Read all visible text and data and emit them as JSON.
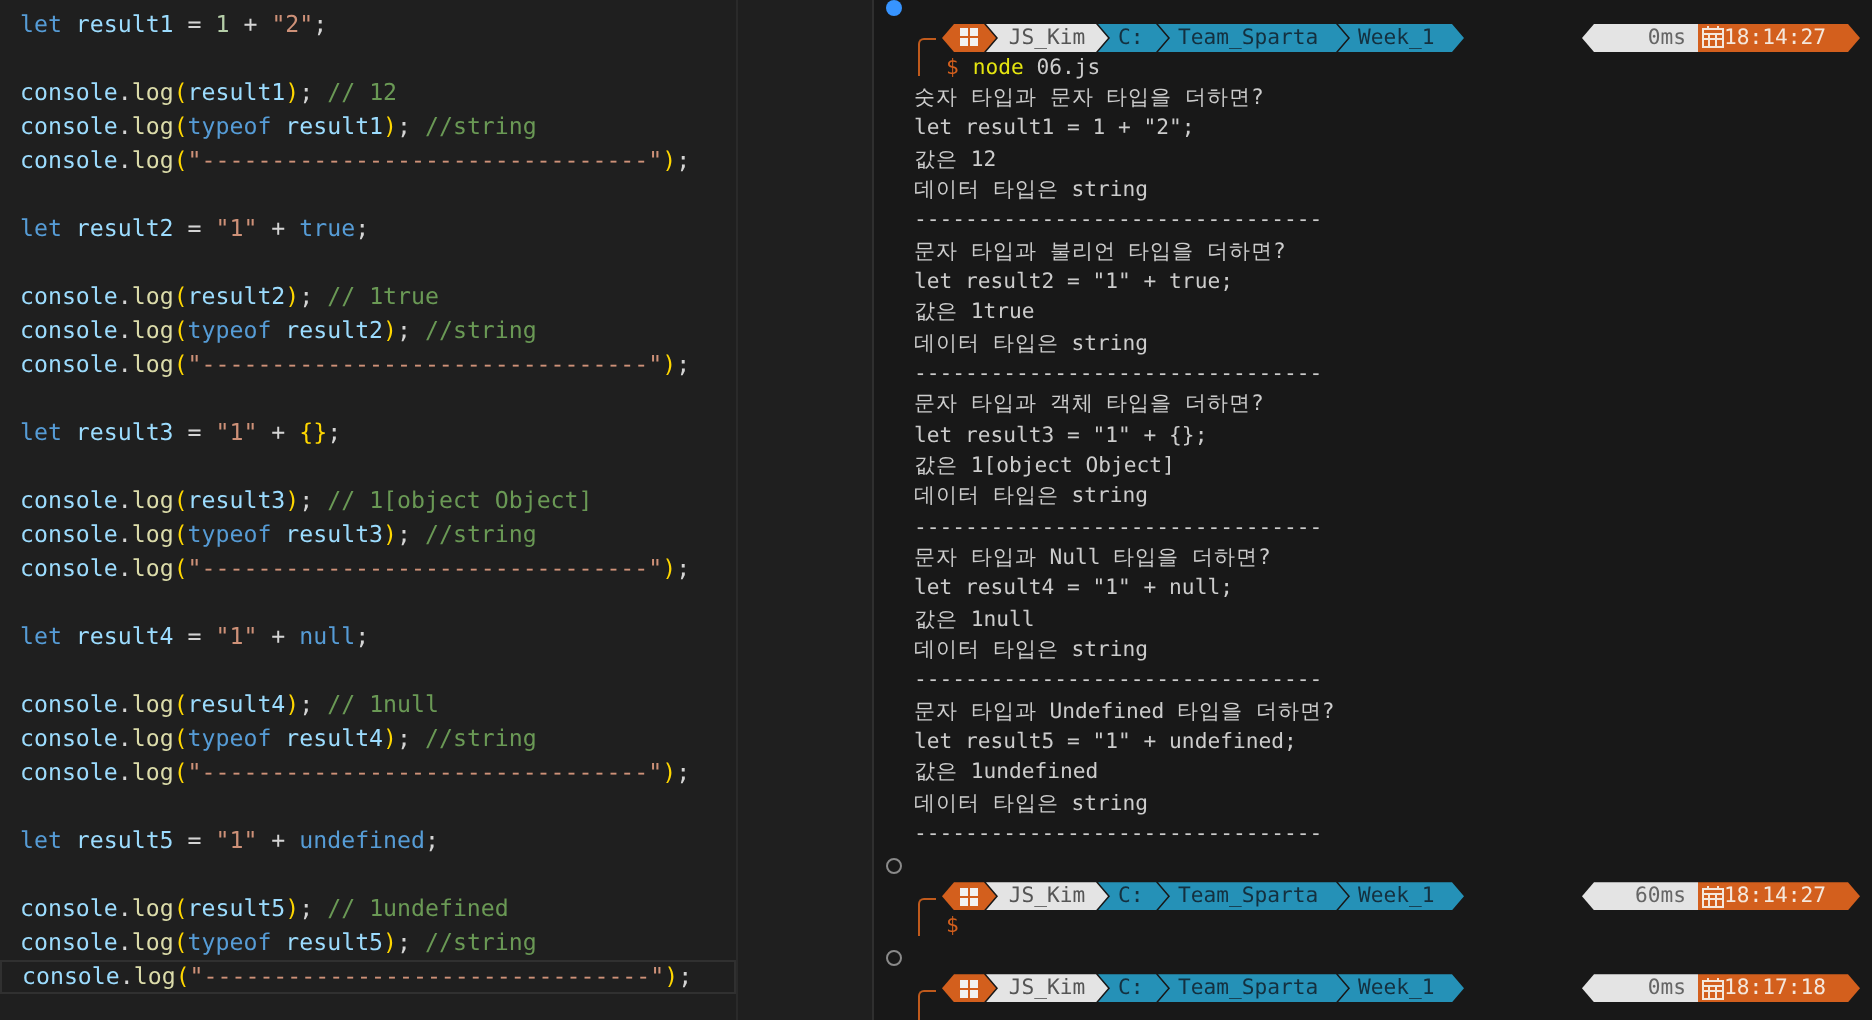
{
  "editor": {
    "lines": [
      {
        "current": false,
        "tokens": [
          {
            "kind": "kw",
            "text": "let "
          },
          {
            "kind": "var",
            "text": "result1"
          },
          {
            "kind": "op",
            "text": " = "
          },
          {
            "kind": "num",
            "text": "1"
          },
          {
            "kind": "op",
            "text": " + "
          },
          {
            "kind": "str",
            "text": "\"2\""
          },
          {
            "kind": "op",
            "text": ";"
          }
        ]
      },
      {
        "current": false
      },
      {
        "current": false,
        "tokens": [
          {
            "kind": "var",
            "text": "console"
          },
          {
            "kind": "op",
            "text": "."
          },
          {
            "kind": "fn",
            "text": "log"
          },
          {
            "kind": "paren",
            "text": "("
          },
          {
            "kind": "var",
            "text": "result1"
          },
          {
            "kind": "paren",
            "text": ")"
          },
          {
            "kind": "op",
            "text": "; "
          },
          {
            "kind": "comment",
            "text": "// 12"
          }
        ]
      },
      {
        "current": false,
        "tokens": [
          {
            "kind": "var",
            "text": "console"
          },
          {
            "kind": "op",
            "text": "."
          },
          {
            "kind": "fn",
            "text": "log"
          },
          {
            "kind": "paren",
            "text": "("
          },
          {
            "kind": "kw",
            "text": "typeof "
          },
          {
            "kind": "var",
            "text": "result1"
          },
          {
            "kind": "paren",
            "text": ")"
          },
          {
            "kind": "op",
            "text": "; "
          },
          {
            "kind": "comment",
            "text": "//string"
          }
        ]
      },
      {
        "current": false,
        "tokens": [
          {
            "kind": "var",
            "text": "console"
          },
          {
            "kind": "op",
            "text": "."
          },
          {
            "kind": "fn",
            "text": "log"
          },
          {
            "kind": "paren",
            "text": "("
          },
          {
            "kind": "str",
            "text": "\"--------------------------------\""
          },
          {
            "kind": "paren",
            "text": ")"
          },
          {
            "kind": "op",
            "text": ";"
          }
        ]
      },
      {
        "current": false
      },
      {
        "current": false,
        "tokens": [
          {
            "kind": "kw",
            "text": "let "
          },
          {
            "kind": "var",
            "text": "result2"
          },
          {
            "kind": "op",
            "text": " = "
          },
          {
            "kind": "str",
            "text": "\"1\""
          },
          {
            "kind": "op",
            "text": " + "
          },
          {
            "kind": "kw",
            "text": "true"
          },
          {
            "kind": "op",
            "text": ";"
          }
        ]
      },
      {
        "current": false
      },
      {
        "current": false,
        "tokens": [
          {
            "kind": "var",
            "text": "console"
          },
          {
            "kind": "op",
            "text": "."
          },
          {
            "kind": "fn",
            "text": "log"
          },
          {
            "kind": "paren",
            "text": "("
          },
          {
            "kind": "var",
            "text": "result2"
          },
          {
            "kind": "paren",
            "text": ")"
          },
          {
            "kind": "op",
            "text": "; "
          },
          {
            "kind": "comment",
            "text": "// 1true"
          }
        ]
      },
      {
        "current": false,
        "tokens": [
          {
            "kind": "var",
            "text": "console"
          },
          {
            "kind": "op",
            "text": "."
          },
          {
            "kind": "fn",
            "text": "log"
          },
          {
            "kind": "paren",
            "text": "("
          },
          {
            "kind": "kw",
            "text": "typeof "
          },
          {
            "kind": "var",
            "text": "result2"
          },
          {
            "kind": "paren",
            "text": ")"
          },
          {
            "kind": "op",
            "text": "; "
          },
          {
            "kind": "comment",
            "text": "//string"
          }
        ]
      },
      {
        "current": false,
        "tokens": [
          {
            "kind": "var",
            "text": "console"
          },
          {
            "kind": "op",
            "text": "."
          },
          {
            "kind": "fn",
            "text": "log"
          },
          {
            "kind": "paren",
            "text": "("
          },
          {
            "kind": "str",
            "text": "\"--------------------------------\""
          },
          {
            "kind": "paren",
            "text": ")"
          },
          {
            "kind": "op",
            "text": ";"
          }
        ]
      },
      {
        "current": false
      },
      {
        "current": false,
        "tokens": [
          {
            "kind": "kw",
            "text": "let "
          },
          {
            "kind": "var",
            "text": "result3"
          },
          {
            "kind": "op",
            "text": " = "
          },
          {
            "kind": "str",
            "text": "\"1\""
          },
          {
            "kind": "op",
            "text": " + "
          },
          {
            "kind": "paren",
            "text": "{}"
          },
          {
            "kind": "op",
            "text": ";"
          }
        ]
      },
      {
        "current": false
      },
      {
        "current": false,
        "tokens": [
          {
            "kind": "var",
            "text": "console"
          },
          {
            "kind": "op",
            "text": "."
          },
          {
            "kind": "fn",
            "text": "log"
          },
          {
            "kind": "paren",
            "text": "("
          },
          {
            "kind": "var",
            "text": "result3"
          },
          {
            "kind": "paren",
            "text": ")"
          },
          {
            "kind": "op",
            "text": "; "
          },
          {
            "kind": "comment",
            "text": "// 1[object Object]"
          }
        ]
      },
      {
        "current": false,
        "tokens": [
          {
            "kind": "var",
            "text": "console"
          },
          {
            "kind": "op",
            "text": "."
          },
          {
            "kind": "fn",
            "text": "log"
          },
          {
            "kind": "paren",
            "text": "("
          },
          {
            "kind": "kw",
            "text": "typeof "
          },
          {
            "kind": "var",
            "text": "result3"
          },
          {
            "kind": "paren",
            "text": ")"
          },
          {
            "kind": "op",
            "text": "; "
          },
          {
            "kind": "comment",
            "text": "//string"
          }
        ]
      },
      {
        "current": false,
        "tokens": [
          {
            "kind": "var",
            "text": "console"
          },
          {
            "kind": "op",
            "text": "."
          },
          {
            "kind": "fn",
            "text": "log"
          },
          {
            "kind": "paren",
            "text": "("
          },
          {
            "kind": "str",
            "text": "\"--------------------------------\""
          },
          {
            "kind": "paren",
            "text": ")"
          },
          {
            "kind": "op",
            "text": ";"
          }
        ]
      },
      {
        "current": false
      },
      {
        "current": false,
        "tokens": [
          {
            "kind": "kw",
            "text": "let "
          },
          {
            "kind": "var",
            "text": "result4"
          },
          {
            "kind": "op",
            "text": " = "
          },
          {
            "kind": "str",
            "text": "\"1\""
          },
          {
            "kind": "op",
            "text": " + "
          },
          {
            "kind": "kw",
            "text": "null"
          },
          {
            "kind": "op",
            "text": ";"
          }
        ]
      },
      {
        "current": false
      },
      {
        "current": false,
        "tokens": [
          {
            "kind": "var",
            "text": "console"
          },
          {
            "kind": "op",
            "text": "."
          },
          {
            "kind": "fn",
            "text": "log"
          },
          {
            "kind": "paren",
            "text": "("
          },
          {
            "kind": "var",
            "text": "result4"
          },
          {
            "kind": "paren",
            "text": ")"
          },
          {
            "kind": "op",
            "text": "; "
          },
          {
            "kind": "comment",
            "text": "// 1null"
          }
        ]
      },
      {
        "current": false,
        "tokens": [
          {
            "kind": "var",
            "text": "console"
          },
          {
            "kind": "op",
            "text": "."
          },
          {
            "kind": "fn",
            "text": "log"
          },
          {
            "kind": "paren",
            "text": "("
          },
          {
            "kind": "kw",
            "text": "typeof "
          },
          {
            "kind": "var",
            "text": "result4"
          },
          {
            "kind": "paren",
            "text": ")"
          },
          {
            "kind": "op",
            "text": "; "
          },
          {
            "kind": "comment",
            "text": "//string"
          }
        ]
      },
      {
        "current": false,
        "tokens": [
          {
            "kind": "var",
            "text": "console"
          },
          {
            "kind": "op",
            "text": "."
          },
          {
            "kind": "fn",
            "text": "log"
          },
          {
            "kind": "paren",
            "text": "("
          },
          {
            "kind": "str",
            "text": "\"--------------------------------\""
          },
          {
            "kind": "paren",
            "text": ")"
          },
          {
            "kind": "op",
            "text": ";"
          }
        ]
      },
      {
        "current": false
      },
      {
        "current": false,
        "tokens": [
          {
            "kind": "kw",
            "text": "let "
          },
          {
            "kind": "var",
            "text": "result5"
          },
          {
            "kind": "op",
            "text": " = "
          },
          {
            "kind": "str",
            "text": "\"1\""
          },
          {
            "kind": "op",
            "text": " + "
          },
          {
            "kind": "kw",
            "text": "undefined"
          },
          {
            "kind": "op",
            "text": ";"
          }
        ]
      },
      {
        "current": false
      },
      {
        "current": false,
        "tokens": [
          {
            "kind": "var",
            "text": "console"
          },
          {
            "kind": "op",
            "text": "."
          },
          {
            "kind": "fn",
            "text": "log"
          },
          {
            "kind": "paren",
            "text": "("
          },
          {
            "kind": "var",
            "text": "result5"
          },
          {
            "kind": "paren",
            "text": ")"
          },
          {
            "kind": "op",
            "text": "; "
          },
          {
            "kind": "comment",
            "text": "// 1undefined"
          }
        ]
      },
      {
        "current": false,
        "tokens": [
          {
            "kind": "var",
            "text": "console"
          },
          {
            "kind": "op",
            "text": "."
          },
          {
            "kind": "fn",
            "text": "log"
          },
          {
            "kind": "paren",
            "text": "("
          },
          {
            "kind": "kw",
            "text": "typeof "
          },
          {
            "kind": "var",
            "text": "result5"
          },
          {
            "kind": "paren",
            "text": ")"
          },
          {
            "kind": "op",
            "text": "; "
          },
          {
            "kind": "comment",
            "text": "//string"
          }
        ]
      },
      {
        "current": true,
        "tokens": [
          {
            "kind": "var",
            "text": "console"
          },
          {
            "kind": "op",
            "text": "."
          },
          {
            "kind": "fn",
            "text": "log"
          },
          {
            "kind": "paren",
            "text": "("
          },
          {
            "kind": "str",
            "text": "\"--------------------------------\""
          },
          {
            "kind": "paren",
            "text": ")"
          },
          {
            "kind": "op",
            "text": ";"
          }
        ]
      }
    ]
  },
  "terminal": {
    "sessions": [
      {
        "kind": "success",
        "prompt": {
          "user": "JS_Kim",
          "path": [
            "C:",
            "Team_Sparta",
            "Week_1"
          ],
          "duration": "0ms",
          "time": "18:14:27"
        },
        "symbol": "$",
        "command": {
          "program": "node",
          "args": " 06.js"
        },
        "output": [
          "숫자 타입과 문자 타입을 더하면?",
          "let result1 = 1 + \"2\";",
          "값은 12",
          "데이터 타입은 string",
          "--------------------------------",
          "문자 타입과 불리언 타입을 더하면?",
          "let result2 = \"1\" + true;",
          "값은 1true",
          "데이터 타입은 string",
          "--------------------------------",
          "문자 타입과 객체 타입을 더하면?",
          "let result3 = \"1\" + {};",
          "값은 1[object Object]",
          "데이터 타입은 string",
          "--------------------------------",
          "문자 타입과 Null 타입을 더하면?",
          "let result4 = \"1\" + null;",
          "값은 1null",
          "데이터 타입은 string",
          "--------------------------------",
          "문자 타입과 Undefined 타입을 더하면?",
          "let result5 = \"1\" + undefined;",
          "값은 1undefined",
          "데이터 타입은 string",
          "--------------------------------"
        ]
      },
      {
        "kind": "empty",
        "prompt": {
          "user": "JS_Kim",
          "path": [
            "C:",
            "Team_Sparta",
            "Week_1"
          ],
          "duration": "60ms",
          "time": "18:14:27"
        },
        "symbol": "$"
      },
      {
        "kind": "empty",
        "prompt": {
          "user": "JS_Kim",
          "path": [
            "C:",
            "Team_Sparta",
            "Week_1"
          ],
          "duration": "0ms",
          "time": "18:17:18"
        }
      }
    ]
  }
}
